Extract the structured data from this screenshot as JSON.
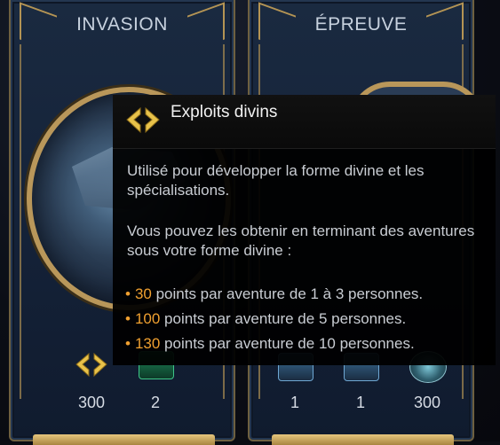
{
  "panels": {
    "left": {
      "title": "INVASION",
      "rewards": [
        {
          "icon": "divine-exploits-icon",
          "count": "300"
        },
        {
          "icon": "green-gem-icon",
          "count": "2"
        }
      ]
    },
    "right": {
      "title": "ÉPREUVE",
      "rewards": [
        {
          "icon": "blue-chip-icon",
          "count": "1"
        },
        {
          "icon": "blue-chip-icon",
          "count": "1"
        },
        {
          "icon": "round-token-icon",
          "count": "300"
        }
      ]
    }
  },
  "tooltip": {
    "title": "Exploits divins",
    "icon": "divine-exploits-icon",
    "description": "Utilisé pour développer la forme divine et les spécialisations.",
    "obtain": "Vous pouvez les obtenir en terminant des aventures sous votre forme divine :",
    "items": [
      {
        "value": "30",
        "text": " points par aventure de 1 à 3 personnes."
      },
      {
        "value": "100",
        "text": " points par aventure de 5 personnes."
      },
      {
        "value": "130",
        "text": " points par aventure de 10 personnes."
      }
    ],
    "bullet": "•",
    "colors": {
      "accent": "#f0a030",
      "text": "#c9cdd3",
      "title": "#f1f1f1"
    }
  }
}
